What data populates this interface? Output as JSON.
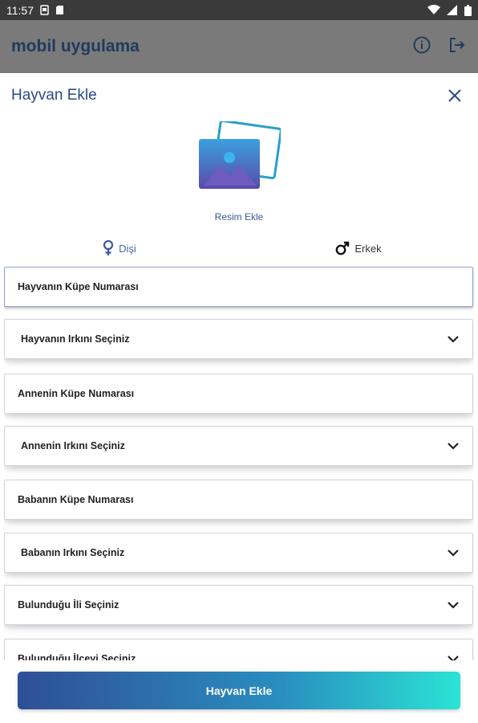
{
  "status_bar": {
    "time": "11:57"
  },
  "app_bar": {
    "title": "mobil uygulama"
  },
  "sheet": {
    "title": "Hayvan Ekle",
    "photo_label": "Resim Ekle",
    "gender": {
      "female": "Dişi",
      "male": "Erkek"
    },
    "fields": [
      {
        "label": "Hayvanın Küpe Numarası",
        "kind": "text"
      },
      {
        "label": "Hayvanın Irkını Seçiniz",
        "kind": "select"
      },
      {
        "label": "Annenin Küpe Numarası",
        "kind": "text"
      },
      {
        "label": "Annenin Irkını Seçiniz",
        "kind": "select"
      },
      {
        "label": "Babanın Küpe Numarası",
        "kind": "text"
      },
      {
        "label": "Babanın Irkını Seçiniz",
        "kind": "select"
      },
      {
        "label": "Bulunduğu İli Seçiniz",
        "kind": "select"
      },
      {
        "label": "Bulunduğu İlçeyi Seçiniz",
        "kind": "select"
      }
    ],
    "submit_label": "Hayvan Ekle"
  },
  "colors": {
    "accent": "#2a4a8a",
    "gradient_start": "#2f4e97",
    "gradient_end": "#2be3d5"
  },
  "icons": [
    "sim-icon",
    "sd-card-icon",
    "wifi-icon",
    "signal-icon",
    "battery-icon",
    "info-icon",
    "logout-icon",
    "close-icon",
    "image-icon",
    "female-icon",
    "male-icon",
    "chevron-down-icon"
  ]
}
